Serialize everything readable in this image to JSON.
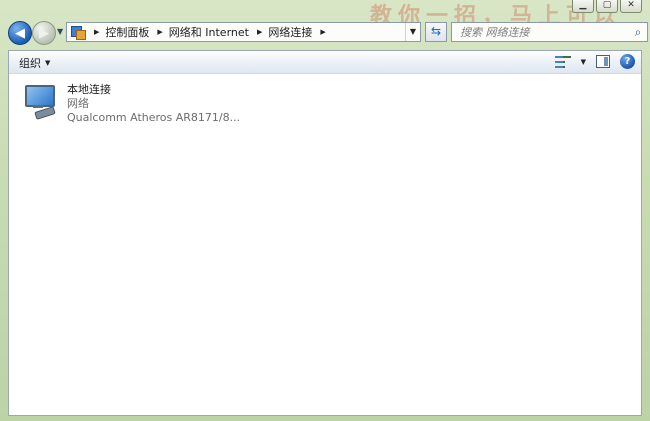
{
  "window": {
    "bg_text": "教你一招，马上可以"
  },
  "address_bar": {
    "crumbs": [
      "控制面板",
      "网络和 Internet",
      "网络连接"
    ]
  },
  "search": {
    "placeholder": "搜索 网络连接"
  },
  "toolbar": {
    "organize_label": "组织"
  },
  "connections": [
    {
      "name": "本地连接",
      "status": "网络",
      "device": "Qualcomm Atheros AR8171/8..."
    }
  ],
  "colors": {
    "window_frame": "#c9dcb3",
    "accent_blue": "#1d5cb3",
    "secondary_text": "#6d6d6d"
  }
}
